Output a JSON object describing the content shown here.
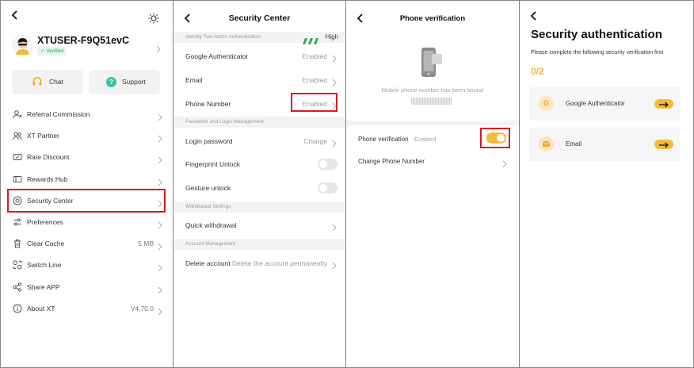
{
  "colors": {
    "accent": "#f6b93b",
    "highlight": "#e0161e",
    "success": "#2aa84a"
  },
  "panel1": {
    "username": "XTUSER-F9Q51evC",
    "verified": "✓ Verified",
    "chat": "Chat",
    "support": "Support",
    "menu": [
      {
        "label": "Referral Commission",
        "value": "",
        "icon": "share-person-icon"
      },
      {
        "label": "XT Partner",
        "value": "",
        "icon": "partner-icon"
      },
      {
        "label": "Rate Discount",
        "value": "",
        "icon": "ticket-icon"
      },
      {
        "label": "Rewards Hub",
        "value": "",
        "icon": "gift-card-icon"
      },
      {
        "label": "Security Center",
        "value": "",
        "icon": "shield-icon"
      },
      {
        "label": "Preferences",
        "value": "",
        "icon": "sliders-icon"
      },
      {
        "label": "Clear Cache",
        "value": "5 MB",
        "icon": "trash-icon"
      },
      {
        "label": "Switch Line",
        "value": "",
        "icon": "switch-icon"
      },
      {
        "label": "Share APP",
        "value": "",
        "icon": "share-icon"
      },
      {
        "label": "About XT",
        "value": "V4.70.0",
        "icon": "info-icon"
      }
    ]
  },
  "panel2": {
    "title": "Security Center",
    "section1": "Identity Two-factor Authentication",
    "level": "High",
    "google": {
      "label": "Google Authenticator",
      "value": "Enabled"
    },
    "email": {
      "label": "Email",
      "value": "Enabled"
    },
    "phone": {
      "label": "Phone Number",
      "value": "Enabled"
    },
    "section2": "Password and Login Management",
    "login": {
      "label": "Login password",
      "value": "Change"
    },
    "fingerprint": "Fingerprint Unlock",
    "gesture": "Gesture unlock",
    "section3": "Withdrawal Settings",
    "quick": "Quick withdrawal",
    "section4": "Account Management",
    "delete": {
      "label": "Delete account",
      "value": "Delete the account permanently"
    }
  },
  "panel3": {
    "title": "Phone verification",
    "bound_text": "Mobile phone number has been bound",
    "masked_number": "",
    "row_label": "Phone verification",
    "row_status": "Enabled",
    "toggle_on": true,
    "change": "Change Phone Number"
  },
  "panel4": {
    "title": "Security authentication",
    "subtitle": "Please complete the following security verification first",
    "progress": "0/2",
    "methods": [
      {
        "label": "Google Authenticator",
        "icon": "google-icon"
      },
      {
        "label": "Email",
        "icon": "mail-icon"
      }
    ]
  }
}
